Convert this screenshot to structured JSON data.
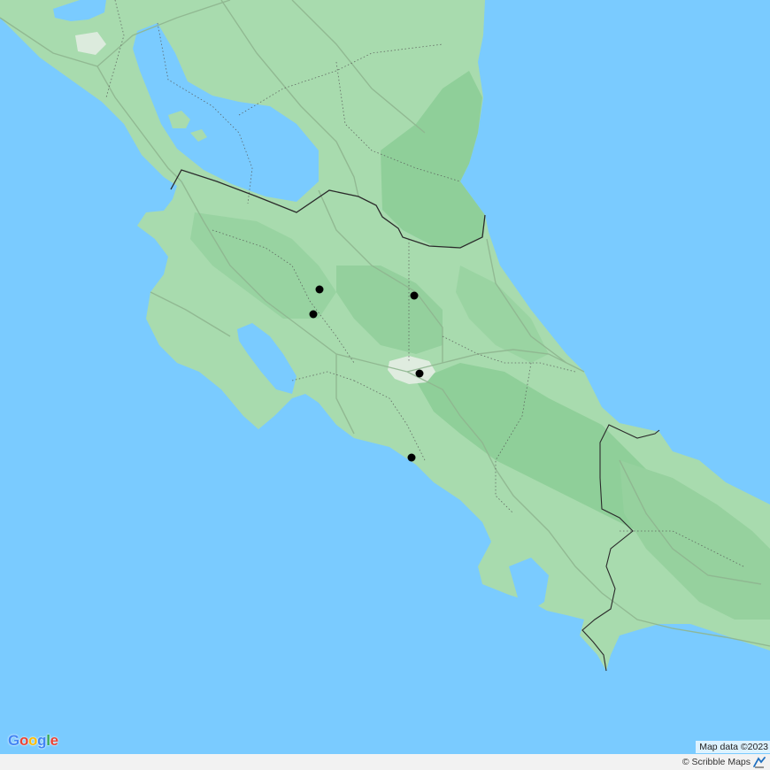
{
  "map": {
    "colors": {
      "water": "#7acbff",
      "land": "#a8dbae",
      "land_forest": "#96d19e",
      "land_dark": "#88c994",
      "road": "#8fb690",
      "admin_border": "#555555",
      "country_border": "#2b2b2b",
      "city": "#e9efe8",
      "marker": "#000000"
    },
    "markers": [
      {
        "name": "marker-1"
      },
      {
        "name": "marker-2"
      },
      {
        "name": "marker-3"
      },
      {
        "name": "marker-4"
      },
      {
        "name": "marker-5"
      }
    ]
  },
  "branding": {
    "logo_letters": [
      "G",
      "o",
      "o",
      "g",
      "l",
      "e"
    ],
    "logo_colors": [
      "#4285F4",
      "#EA4335",
      "#FBBC05",
      "#4285F4",
      "#34A853",
      "#EA4335"
    ]
  },
  "attribution": {
    "map_data": "Map data ©2023"
  },
  "footer": {
    "credit": "© Scribble Maps",
    "icon": "scribble-maps-icon"
  }
}
